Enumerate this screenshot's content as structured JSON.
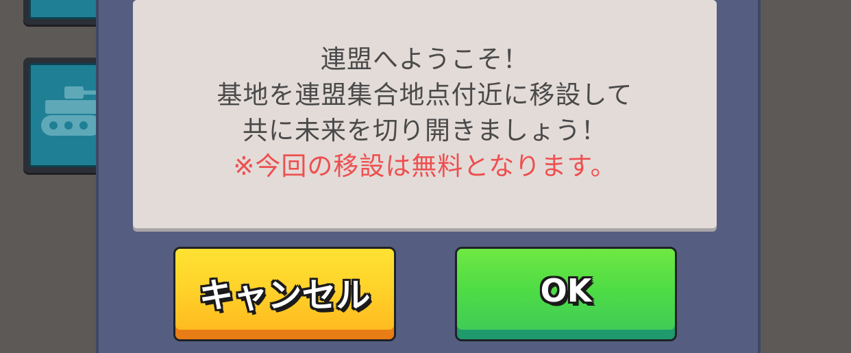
{
  "message": {
    "lines": [
      "連盟へようこそ！",
      "基地を連盟集合地点付近に移設して",
      "共に未来を切り開きましょう！"
    ],
    "note": "※今回の移設は無料となります。"
  },
  "buttons": {
    "cancel_label": "キャンセル",
    "ok_label": "OK"
  },
  "colors": {
    "dialog_bg": "#555e80",
    "message_bg": "#e3dbd8",
    "note_text": "#ee4f4f",
    "cancel_button": "#ffd22a",
    "ok_button": "#4fdc45"
  },
  "icons": {
    "background_tile_icon": "tank-icon"
  }
}
